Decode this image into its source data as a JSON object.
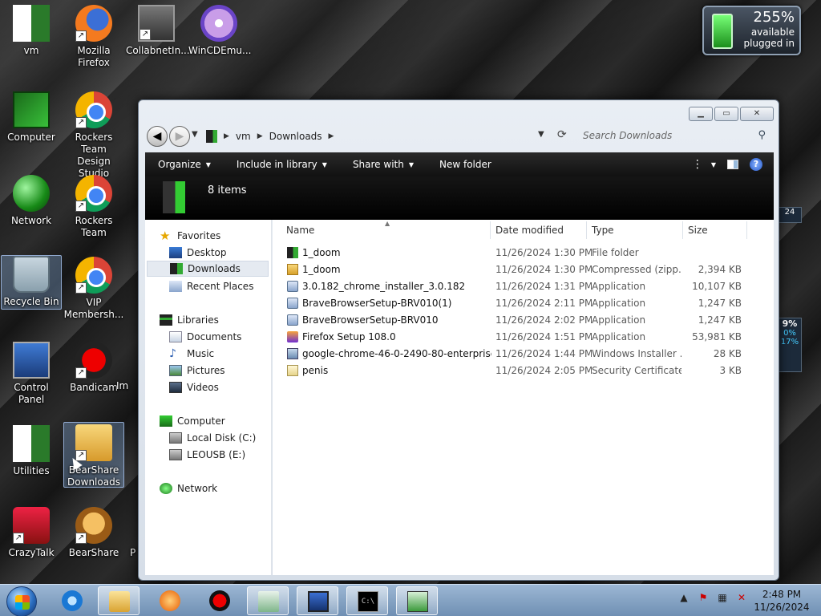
{
  "desktop": {
    "icons": [
      {
        "label": "vm"
      },
      {
        "label": "Mozilla Firefox"
      },
      {
        "label": "CollabnetIn..."
      },
      {
        "label": "WinCDEmu..."
      },
      {
        "label": "Computer"
      },
      {
        "label": "Rockers Team Design Studio"
      },
      {
        "label": "Network"
      },
      {
        "label": "Rockers Team"
      },
      {
        "label": "Recycle Bin"
      },
      {
        "label": "VIP Membersh..."
      },
      {
        "label": "Control Panel"
      },
      {
        "label": "Bandicam"
      },
      {
        "label": "Im"
      },
      {
        "label": "Utilities"
      },
      {
        "label": "BearShare Downloads"
      },
      {
        "label": "CrazyTalk"
      },
      {
        "label": "BearShare"
      },
      {
        "label": "P"
      }
    ]
  },
  "battery": {
    "percent": "255%",
    "status1": "available",
    "status2": "plugged in"
  },
  "gadgets": {
    "right_top": "24",
    "cpu_pct": "9%",
    "mem1": "0%",
    "mem2": "17%"
  },
  "window": {
    "breadcrumb": [
      "vm",
      "Downloads"
    ],
    "search_placeholder": "Search Downloads",
    "toolbar": {
      "organize": "Organize",
      "include": "Include in library",
      "share": "Share with",
      "new_folder": "New folder"
    },
    "info": {
      "count": "8 items"
    },
    "navpane": {
      "favorites": "Favorites",
      "desktop": "Desktop",
      "downloads": "Downloads",
      "recent": "Recent Places",
      "libraries": "Libraries",
      "documents": "Documents",
      "music": "Music",
      "pictures": "Pictures",
      "videos": "Videos",
      "computer": "Computer",
      "local_disk": "Local Disk (C:)",
      "leousb": "LEOUSB (E:)",
      "network": "Network"
    },
    "columns": {
      "name": "Name",
      "date": "Date modified",
      "type": "Type",
      "size": "Size"
    },
    "files": [
      {
        "name": "1_doom",
        "date": "11/26/2024 1:30 PM",
        "type": "File folder",
        "size": ""
      },
      {
        "name": "1_doom",
        "date": "11/26/2024 1:30 PM",
        "type": "Compressed (zipp...",
        "size": "2,394 KB"
      },
      {
        "name": "3.0.182_chrome_installer_3.0.182",
        "date": "11/26/2024 1:31 PM",
        "type": "Application",
        "size": "10,107 KB"
      },
      {
        "name": "BraveBrowserSetup-BRV010(1)",
        "date": "11/26/2024 2:11 PM",
        "type": "Application",
        "size": "1,247 KB"
      },
      {
        "name": "BraveBrowserSetup-BRV010",
        "date": "11/26/2024 2:02 PM",
        "type": "Application",
        "size": "1,247 KB"
      },
      {
        "name": "Firefox Setup 108.0",
        "date": "11/26/2024 1:51 PM",
        "type": "Application",
        "size": "53,981 KB"
      },
      {
        "name": "google-chrome-46-0-2490-80-enterprise...",
        "date": "11/26/2024 1:44 PM",
        "type": "Windows Installer ...",
        "size": "28 KB"
      },
      {
        "name": "penis",
        "date": "11/26/2024 2:05 PM",
        "type": "Security Certificate",
        "size": "3 KB"
      }
    ]
  },
  "taskbar": {
    "time": "2:48 PM",
    "date": "11/26/2024"
  }
}
